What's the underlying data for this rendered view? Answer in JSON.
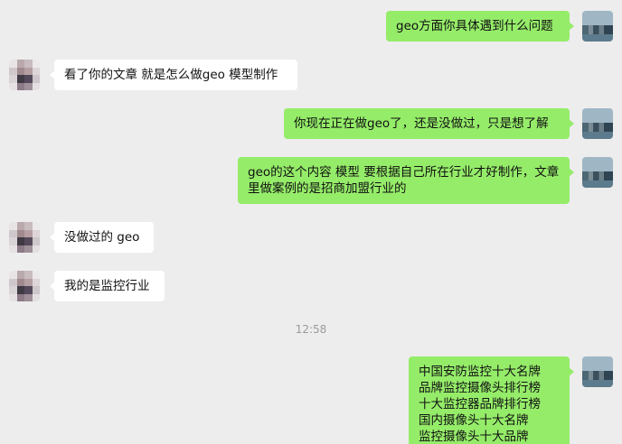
{
  "messages": [
    {
      "side": "me",
      "text": "geo方面你具体遇到什么问题"
    },
    {
      "side": "other",
      "text": "看了你的文章 就是怎么做geo 模型制作"
    },
    {
      "side": "me",
      "text": "你现在正在做geo了，还是没做过，只是想了解"
    },
    {
      "side": "me",
      "text": "geo的这个内容 模型 要根据自己所在行业才好制作，文章里做案例的是招商加盟行业的"
    },
    {
      "side": "other",
      "text": "没做过的 geo"
    },
    {
      "side": "other",
      "text": "我的是监控行业"
    },
    {
      "side": "me",
      "text": "中国安防监控十大名牌\n品牌监控摄像头排行榜\n十大监控器品牌排行榜\n国内摄像头十大名牌\n监控摄像头十大品牌"
    }
  ],
  "timestamp": "12:58",
  "colors": {
    "background": "#ededed",
    "self_bubble": "#95ec69",
    "other_bubble": "#ffffff"
  },
  "icons": {
    "self_avatar": "city-skyline-avatar-icon",
    "other_avatar": "pixelated-avatar-icon"
  }
}
